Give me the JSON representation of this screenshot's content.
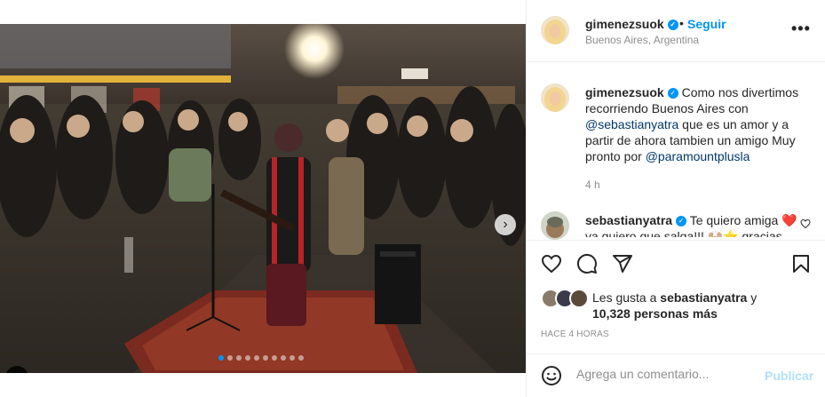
{
  "post": {
    "username": "gimenezsuok",
    "follow_label": "Seguir",
    "separator": "•",
    "location": "Buenos Aires, Argentina",
    "more_label": "•••"
  },
  "caption": {
    "username": "gimenezsuok",
    "text_1": "Como nos divertimos recorriendo Buenos Aires con",
    "mention_1": "@sebastianyatra",
    "text_2": "que es un amor y a partir de ahora tambien un amigo Muy pronto por",
    "mention_2": "@paramountplusla",
    "time": "4 h"
  },
  "comment": {
    "username": "sebastianyatra",
    "text": "Te quiero amiga ❤️ ya quiero que salga!!! 🙌🏼⭐ gracias"
  },
  "likes": {
    "prefix": "Les gusta a",
    "user": "sebastianyatra",
    "middle": "y",
    "count": "10,328 personas más"
  },
  "timestamp": "Hace 4 horas",
  "comment_box": {
    "placeholder": "Agrega un comentario...",
    "publish_label": "Publicar"
  },
  "carousel": {
    "slide_count": 10,
    "active_index": 0
  },
  "colors": {
    "accent": "#0095f6",
    "heart_red": "#ed4956",
    "publish_disabled": "#b2dffc"
  }
}
